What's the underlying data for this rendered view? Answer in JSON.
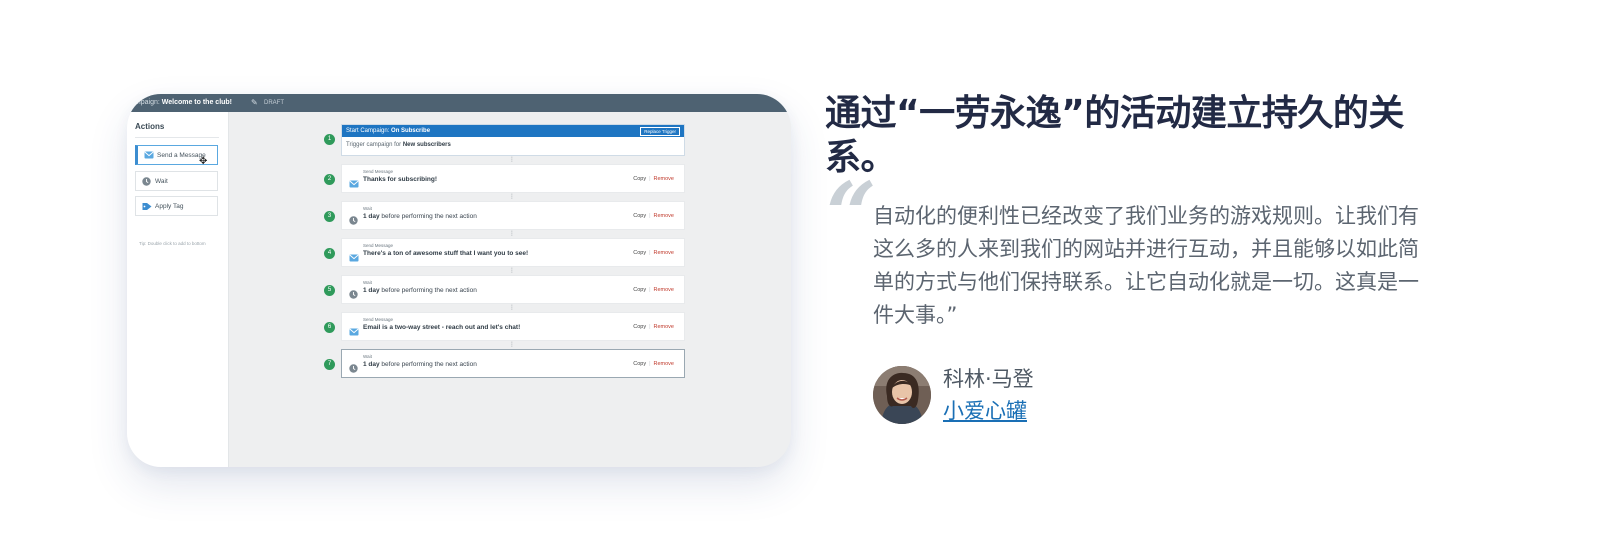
{
  "campaign": {
    "prefix": "ampaign:",
    "name": "Welcome to the club!",
    "status": "DRAFT"
  },
  "sidebar": {
    "title": "Actions",
    "items": [
      {
        "label": "Send a Message",
        "icon": "envelope-icon"
      },
      {
        "label": "Wait",
        "icon": "clock-icon"
      },
      {
        "label": "Apply Tag",
        "icon": "tag-icon"
      }
    ],
    "tip": "Tip: Double click to add to bottom"
  },
  "trigger": {
    "number": "1",
    "head_prefix": "Start Campaign: ",
    "head_value": "On Subscribe",
    "replace_label": "Replace Trigger",
    "body_prefix": "Trigger campaign for ",
    "body_value": "New subscribers"
  },
  "steps": [
    {
      "number": "2",
      "type": "message",
      "small": "Send Message",
      "title_bold": "Thanks for subscribing!",
      "title_rest": ""
    },
    {
      "number": "3",
      "type": "wait",
      "small": "Wait",
      "title_bold": "1 day",
      "title_rest": " before performing the next action"
    },
    {
      "number": "4",
      "type": "message",
      "small": "Send Message",
      "title_bold": "There's a ton of awesome stuff that I want you to see!",
      "title_rest": ""
    },
    {
      "number": "5",
      "type": "wait",
      "small": "Wait",
      "title_bold": "1 day",
      "title_rest": " before performing the next action"
    },
    {
      "number": "6",
      "type": "message",
      "small": "Send Message",
      "title_bold": "Email is a two-way street - reach out and let's chat!",
      "title_rest": ""
    },
    {
      "number": "7",
      "type": "wait",
      "small": "Wait",
      "title_bold": "1 day",
      "title_rest": " before performing the next action"
    }
  ],
  "step_actions": {
    "copy": "Copy",
    "remove": "Remove"
  },
  "colors": {
    "topbar": "#4e6272",
    "trigger_head": "#1e75c2",
    "step_number": "#2f9a5b",
    "remove": "#c0392b",
    "headline": "#222a45",
    "link": "#1a6fb5"
  },
  "testimonial": {
    "headline": "通过“一劳永逸”的活动建立持久的关系。",
    "quote": "自动化的便利性已经改变了我们业务的游戏规则。让我们有这么多的人来到我们的网站并进行互动，并且能够以如此简单的方式与他们保持联系。让它自动化就是一切。这真是一件大事。”",
    "author_name": "科林·马登",
    "author_org": "小爱心罐"
  }
}
